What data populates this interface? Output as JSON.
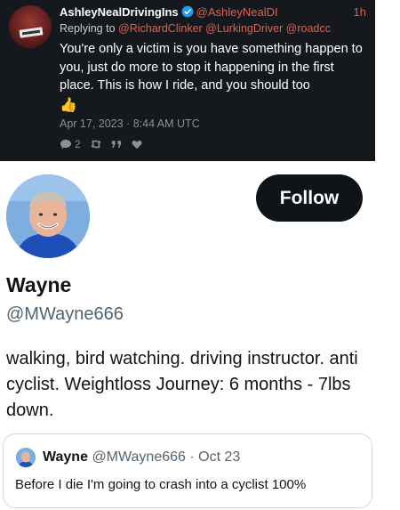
{
  "original_tweet": {
    "author_name": "AshleyNealDrivingIns",
    "author_handle": "@AshleyNealDI",
    "time_ago": "1h",
    "replying_to_prefix": "Replying to",
    "replying_to": "@RichardClinker @LurkingDriver @roadcc",
    "text": "You're only a victim is you have something happen to you, just do more to stop it happening in the first place. This is how I ride, and you should too",
    "emoji": "👍",
    "date": "Apr 17, 2023 · 8:44 AM UTC",
    "reply_count": "2",
    "icons": [
      "reply-icon",
      "retweet-icon",
      "quote-icon",
      "like-icon"
    ]
  },
  "profile": {
    "name": "Wayne",
    "handle": "@MWayne666",
    "follow_label": "Follow",
    "bio": "walking, bird watching. driving instructor. anti cyclist. Weightloss Journey: 6 months - 7lbs down."
  },
  "quoted_tweet": {
    "name": "Wayne",
    "meta": "@MWayne666 · Oct 23",
    "text": "Before I die I'm going to crash into a cyclist 100%"
  },
  "colors": {
    "dark_bg": "#15181c",
    "link_red": "#e0604e",
    "verified_blue": "#1d9bf0",
    "button_bg": "#0f1419"
  }
}
